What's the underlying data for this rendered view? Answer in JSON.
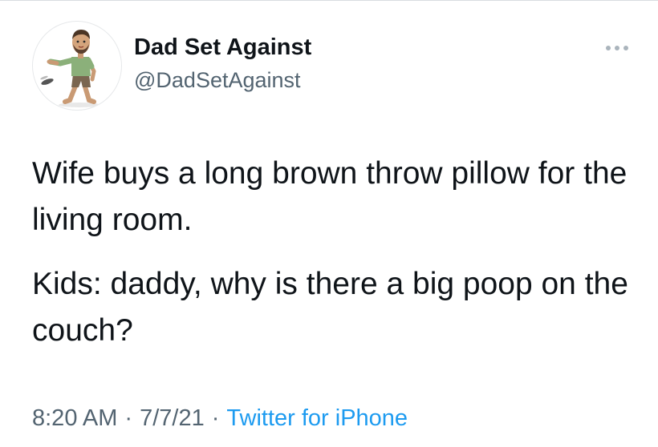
{
  "author": {
    "display_name": "Dad Set Against",
    "handle": "@DadSetAgainst",
    "avatar_icon": "cartoon-dad-avatar-icon"
  },
  "menu": {
    "icon": "more-horizontal-icon"
  },
  "tweet": {
    "paragraphs": [
      "Wife buys a long brown throw pillow for the living room.",
      "Kids: daddy, why is there a big poop on the couch?"
    ]
  },
  "meta": {
    "time": "8:20 AM",
    "date": "7/7/21",
    "source": "Twitter for iPhone",
    "separator": "·"
  },
  "colors": {
    "text": "#0f1419",
    "secondary": "#536471",
    "link": "#1d9bf0"
  }
}
